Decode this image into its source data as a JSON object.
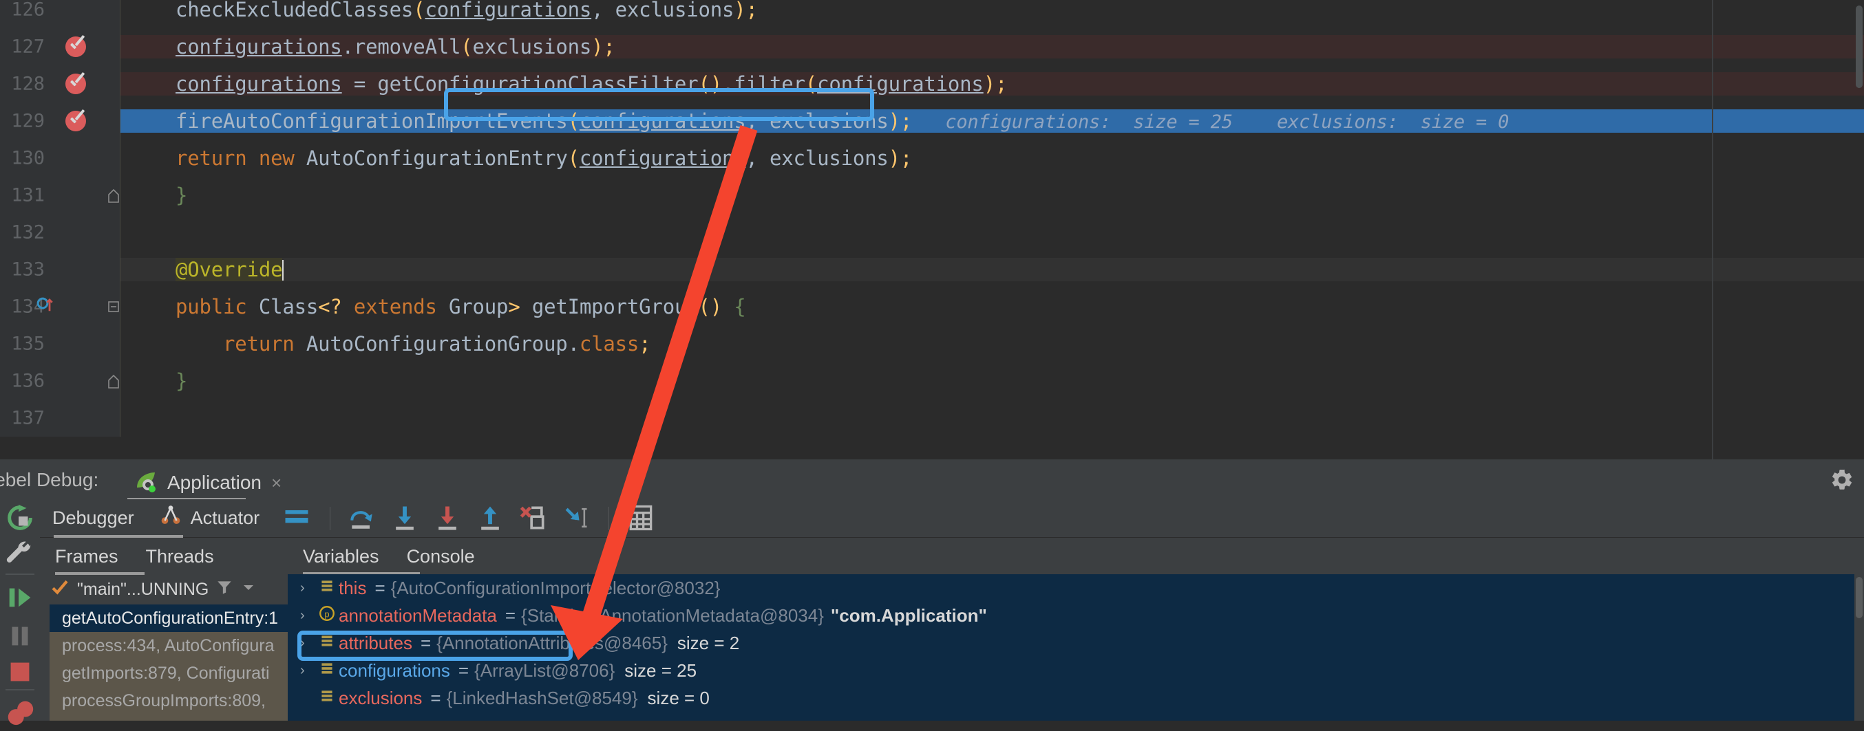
{
  "editor": {
    "lines": [
      {
        "num": "126",
        "breakpoint": false,
        "fold": "",
        "state": "normal",
        "tokens": [
          {
            "t": "checkExcludedClasses",
            "c": "plain"
          },
          {
            "t": "(",
            "c": "pn"
          },
          {
            "t": "configurations",
            "c": "fld"
          },
          {
            "t": ", ",
            "c": "plain"
          },
          {
            "t": "exclusions",
            "c": "plain"
          },
          {
            "t": ")",
            "c": "pn"
          },
          {
            "t": ";",
            "c": "pn"
          }
        ],
        "inlay": ""
      },
      {
        "num": "127",
        "breakpoint": true,
        "fold": "",
        "state": "hl",
        "tokens": [
          {
            "t": "configurations",
            "c": "fld"
          },
          {
            "t": ".removeAll",
            "c": "plain"
          },
          {
            "t": "(",
            "c": "pn"
          },
          {
            "t": "exclusions",
            "c": "plain"
          },
          {
            "t": ")",
            "c": "pn"
          },
          {
            "t": ";",
            "c": "pn"
          }
        ],
        "inlay": ""
      },
      {
        "num": "128",
        "breakpoint": true,
        "fold": "",
        "state": "hl",
        "tokens": [
          {
            "t": "configurations",
            "c": "fld"
          },
          {
            "t": " = ",
            "c": "plain"
          },
          {
            "t": "getConfigurationClassFilter",
            "c": "plain"
          },
          {
            "t": "()",
            "c": "pn"
          },
          {
            "t": ".filter",
            "c": "plain"
          },
          {
            "t": "(",
            "c": "pn"
          },
          {
            "t": "configurations",
            "c": "fld"
          },
          {
            "t": ")",
            "c": "pn"
          },
          {
            "t": ";",
            "c": "pn"
          }
        ],
        "inlay": ""
      },
      {
        "num": "129",
        "breakpoint": true,
        "fold": "",
        "state": "sel",
        "tokens": [
          {
            "t": "fireAutoConfigurationImportEvents",
            "c": "plain"
          },
          {
            "t": "(",
            "c": "pn"
          },
          {
            "t": "configurations",
            "c": "fld"
          },
          {
            "t": ", ",
            "c": "plain"
          },
          {
            "t": "exclusions",
            "c": "plain"
          },
          {
            "t": ")",
            "c": "pn"
          },
          {
            "t": ";",
            "c": "pn"
          }
        ],
        "inlay": "configurations:  size = 25    exclusions:  size = 0"
      },
      {
        "num": "130",
        "breakpoint": false,
        "fold": "",
        "state": "normal",
        "tokens": [
          {
            "t": "return ",
            "c": "kw"
          },
          {
            "t": "new ",
            "c": "kw"
          },
          {
            "t": "AutoConfigurationEntry",
            "c": "plain"
          },
          {
            "t": "(",
            "c": "pn"
          },
          {
            "t": "configurations",
            "c": "fld"
          },
          {
            "t": ", ",
            "c": "plain"
          },
          {
            "t": "exclusions",
            "c": "plain"
          },
          {
            "t": ")",
            "c": "pn"
          },
          {
            "t": ";",
            "c": "pn"
          }
        ],
        "inlay": ""
      },
      {
        "num": "131",
        "breakpoint": false,
        "fold": "collapse",
        "state": "normal",
        "tokens": [
          {
            "t": "}",
            "c": "brace"
          }
        ],
        "inlay": ""
      },
      {
        "num": "132",
        "breakpoint": false,
        "fold": "",
        "state": "normal",
        "tokens": [],
        "inlay": ""
      },
      {
        "num": "133",
        "breakpoint": false,
        "fold": "",
        "state": "cur",
        "tokens": [
          {
            "t": "@Override",
            "c": "ann"
          },
          {
            "t": "CARET",
            "c": "caret"
          }
        ],
        "inlay": ""
      },
      {
        "num": "134",
        "breakpoint": false,
        "fold": "minus",
        "state": "normal",
        "override_marker": true,
        "tokens": [
          {
            "t": "public ",
            "c": "kw"
          },
          {
            "t": "Class",
            "c": "plain"
          },
          {
            "t": "<? ",
            "c": "pn"
          },
          {
            "t": "extends",
            "c": "kw"
          },
          {
            "t": " Group",
            "c": "plain"
          },
          {
            "t": ">",
            "c": "pn"
          },
          {
            "t": " getImportGroup",
            "c": "plain"
          },
          {
            "t": "()",
            "c": "pn"
          },
          {
            "t": " ",
            "c": "plain"
          },
          {
            "t": "{",
            "c": "brace"
          }
        ],
        "inlay": ""
      },
      {
        "num": "135",
        "breakpoint": false,
        "fold": "",
        "state": "normal",
        "tokens": [
          {
            "t": "    return ",
            "c": "kw"
          },
          {
            "t": "AutoConfigurationGroup",
            "c": "plain"
          },
          {
            "t": ".",
            "c": "plain"
          },
          {
            "t": "class",
            "c": "kw"
          },
          {
            "t": ";",
            "c": "pn"
          }
        ],
        "inlay": ""
      },
      {
        "num": "136",
        "breakpoint": false,
        "fold": "collapse",
        "state": "normal",
        "tokens": [
          {
            "t": "}",
            "c": "brace"
          }
        ],
        "inlay": ""
      },
      {
        "num": "137",
        "breakpoint": false,
        "fold": "",
        "state": "normal",
        "tokens": [],
        "inlay": ""
      }
    ],
    "highlight_box_label": "getConfigurationClassFilter().filter(configurations);"
  },
  "debug_window": {
    "title": "Rebel Debug:",
    "tab_label": "Application",
    "tab_close": "×",
    "settings_icon": "gear-icon",
    "toolbar_tabs": [
      {
        "label": "Debugger",
        "icon": ""
      },
      {
        "label": "Actuator",
        "icon": "actuator-icon"
      }
    ],
    "toolbar_icons": [
      "layout-icon",
      "step-over-icon",
      "step-into-icon",
      "force-step-into-icon",
      "step-out-icon",
      "drop-frame-icon",
      "run-to-cursor-icon",
      "evaluate-expression-icon"
    ],
    "rail_icons": [
      "rerun-icon",
      "settings-wrench-icon",
      "resume-icon",
      "pause-icon",
      "stop-icon",
      "mute-breakpoints-icon"
    ]
  },
  "frames": {
    "tabs": [
      {
        "label": "Frames"
      },
      {
        "label": "Threads"
      }
    ],
    "thread": "\"main\"...UNNING",
    "thread_status_icon": "checkmark-icon",
    "filter_icon": "filter-icon",
    "dropdown_icon": "chevron-down-icon",
    "items": [
      {
        "text": "getAutoConfigurationEntry:1",
        "active": true
      },
      {
        "text": "process:434, AutoConfigura",
        "active": false
      },
      {
        "text": "getImports:879, Configurati",
        "active": false
      },
      {
        "text": "processGroupImports:809,",
        "active": false
      }
    ]
  },
  "variables": {
    "tabs": [
      {
        "label": "Variables"
      },
      {
        "label": "Console"
      }
    ],
    "rows": [
      {
        "expandable": true,
        "icon": "field-icon",
        "name": "this",
        "value": "{AutoConfigurationImportSelector@8032}",
        "size": "",
        "str": "",
        "selected": false,
        "boxed": false
      },
      {
        "expandable": true,
        "icon": "parameter-icon",
        "name": "annotationMetadata",
        "value": "{StandardAnnotationMetadata@8034}",
        "size": "",
        "str": "\"com.Application\"",
        "selected": false,
        "boxed": false
      },
      {
        "expandable": true,
        "icon": "field-icon",
        "name": "attributes",
        "value": "{AnnotationAttributes@8465}",
        "size": "size = 2",
        "str": "",
        "selected": false,
        "boxed": false
      },
      {
        "expandable": true,
        "icon": "field-icon",
        "name": "configurations",
        "value": "{ArrayList@8706}",
        "size": "size = 25",
        "str": "",
        "selected": true,
        "boxed": true
      },
      {
        "expandable": false,
        "icon": "field-icon",
        "name": "exclusions",
        "value": "{LinkedHashSet@8549}",
        "size": "size = 0",
        "str": "",
        "selected": false,
        "boxed": false
      }
    ]
  },
  "annotation": {
    "arrow_color": "#f4442e",
    "highlight_color": "#4aa3e8"
  }
}
